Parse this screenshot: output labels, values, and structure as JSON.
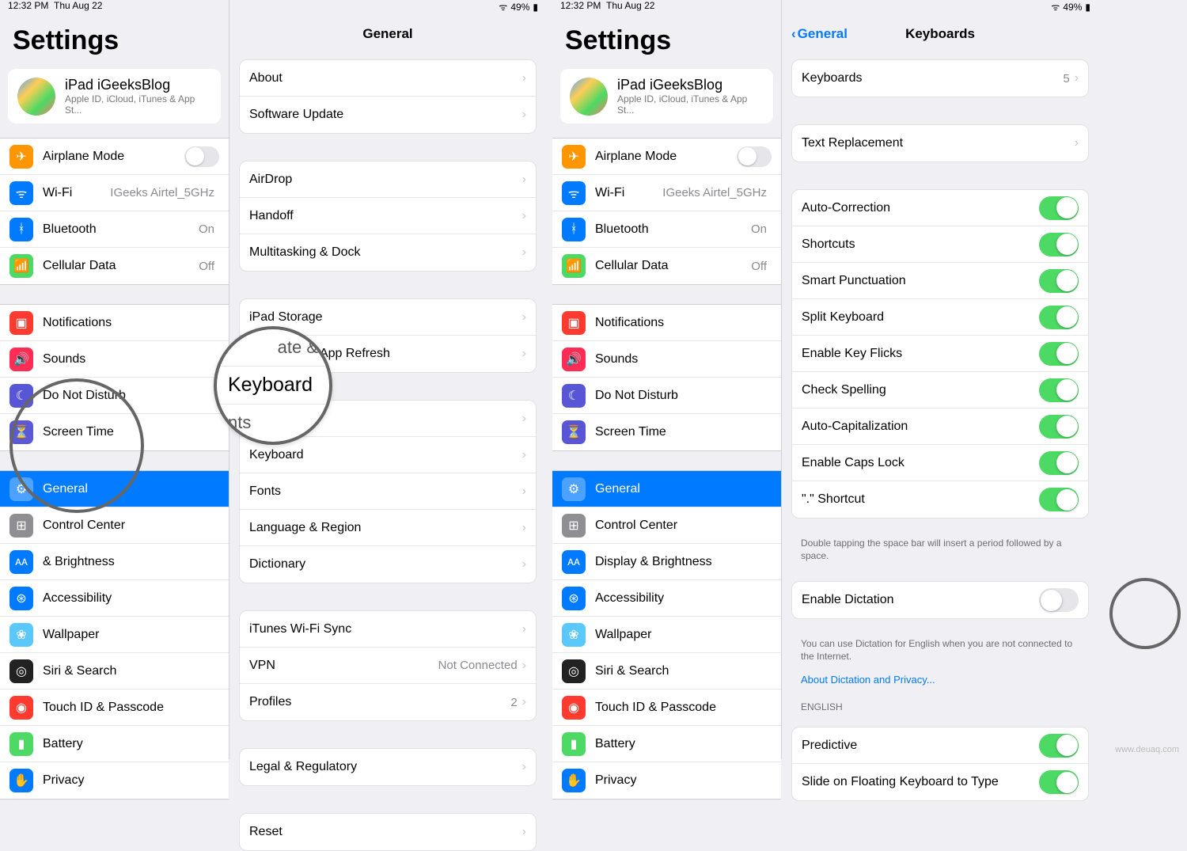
{
  "status": {
    "time": "12:32 PM",
    "date": "Thu Aug 22",
    "battery": "49%"
  },
  "settings_title": "Settings",
  "account": {
    "name": "iPad iGeeksBlog",
    "sub": "Apple ID, iCloud, iTunes & App St..."
  },
  "sidebar": {
    "airplane": "Airplane Mode",
    "wifi": "Wi-Fi",
    "wifi_val": "IGeeks Airtel_5GHz",
    "bluetooth": "Bluetooth",
    "bt_val": "On",
    "cellular": "Cellular Data",
    "cell_val": "Off",
    "notifications": "Notifications",
    "sounds": "Sounds",
    "dnd": "Do Not Disturb",
    "screentime": "Screen Time",
    "general": "General",
    "controlcenter": "Control Center",
    "display": "Display & Brightness",
    "display_short": "& Brightness",
    "accessibility": "Accessibility",
    "wallpaper": "Wallpaper",
    "siri": "Siri & Search",
    "touchid": "Touch ID & Passcode",
    "battery": "Battery",
    "privacy": "Privacy"
  },
  "general": {
    "title": "General",
    "about": "About",
    "software": "Software Update",
    "airdrop": "AirDrop",
    "handoff": "Handoff",
    "multitask": "Multitasking & Dock",
    "storage": "iPad Storage",
    "bgrefresh": "Background App Refresh",
    "datetime": "Date & Time",
    "keyboard": "Keyboard",
    "fonts": "Fonts",
    "langregion": "Language & Region",
    "dictionary": "Dictionary",
    "itunes": "iTunes Wi-Fi Sync",
    "vpn": "VPN",
    "vpn_val": "Not Connected",
    "profiles": "Profiles",
    "profiles_val": "2",
    "legal": "Legal & Regulatory",
    "reset": "Reset"
  },
  "zoom": {
    "date_partial": "ate &",
    "keyboard": "Keyboard",
    "fonts_partial": "nts"
  },
  "keyboards": {
    "back": "General",
    "title": "Keyboards",
    "keyboards_row": "Keyboards",
    "keyboards_count": "5",
    "textrep": "Text Replacement",
    "autocorrect": "Auto-Correction",
    "shortcuts": "Shortcuts",
    "smartpunc": "Smart Punctuation",
    "splitkb": "Split Keyboard",
    "keyflicks": "Enable Key Flicks",
    "checkspell": "Check Spelling",
    "autocap": "Auto-Capitalization",
    "capslock": "Enable Caps Lock",
    "dotshortcut": "\".\" Shortcut",
    "dot_footer": "Double tapping the space bar will insert a period followed by a space.",
    "dictation": "Enable Dictation",
    "dict_footer": "You can use Dictation for English when you are not connected to the Internet.",
    "dict_link": "About Dictation and Privacy...",
    "english_head": "ENGLISH",
    "predictive": "Predictive",
    "slide": "Slide on Floating Keyboard to Type"
  },
  "watermark": "www.deuaq.com"
}
